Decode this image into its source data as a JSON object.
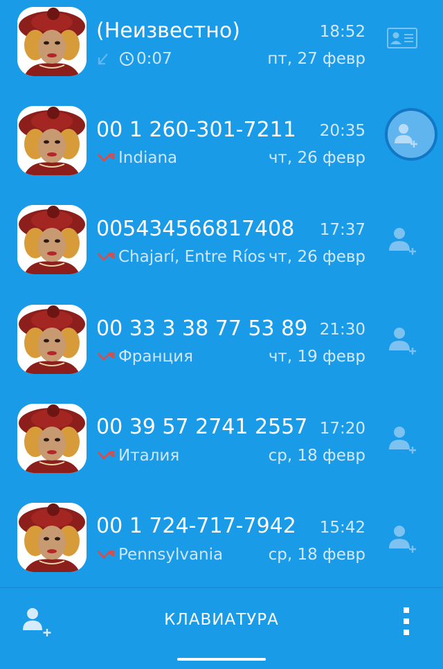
{
  "calls": [
    {
      "number": "(Неизвестно)",
      "time": "18:52",
      "info": "0:07",
      "date": "пт, 27 февр",
      "call_type": "outgoing",
      "action_icon": "contact-card-icon"
    },
    {
      "number": "00 1 260-301-7211",
      "time": "20:35",
      "info": "Indiana",
      "date": "чт, 26 февр",
      "call_type": "missed",
      "action_icon": "add-contact-icon"
    },
    {
      "number": "005434566817408",
      "time": "17:37",
      "info": "Chajarí, Entre Ríos",
      "date": "чт, 26 февр",
      "call_type": "missed",
      "action_icon": "add-contact-icon"
    },
    {
      "number": "00 33 3 38 77 53 89",
      "time": "21:30",
      "info": "Франция",
      "date": "чт, 19 февр",
      "call_type": "missed",
      "action_icon": "add-contact-icon"
    },
    {
      "number": "00 39 57 2741 2557",
      "time": "17:20",
      "info": "Италия",
      "date": "ср, 18 февр",
      "call_type": "missed",
      "action_icon": "add-contact-icon"
    },
    {
      "number": "00 1 724-717-7942",
      "time": "15:42",
      "info": "Pennsylvania",
      "date": "ср, 18 февр",
      "call_type": "missed",
      "action_icon": "add-contact-icon"
    }
  ],
  "bottom_bar": {
    "keypad_label": "КЛАВИАТУРА",
    "add_contact_icon": "add-contact-icon",
    "more_icon": "more-vert-icon"
  },
  "colors": {
    "background": "#1a9be8",
    "missed_call": "#e8473e",
    "secondary_text": "#cfe6fa"
  }
}
